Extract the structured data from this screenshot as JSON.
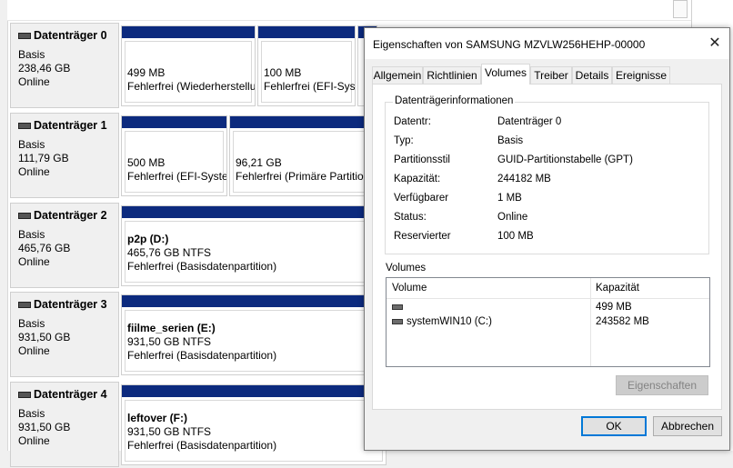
{
  "disks": [
    {
      "name": "Datenträger 0",
      "type": "Basis",
      "size": "238,46 GB",
      "status": "Online",
      "partitions": [
        {
          "title": "",
          "line1": "499 MB",
          "line2": "Fehlerfrei (Wiederherstellu"
        },
        {
          "title": "",
          "line1": "100 MB",
          "line2": "Fehlerfrei (EFI-Syst"
        },
        {
          "title": "",
          "line1": "",
          "line2": ""
        }
      ]
    },
    {
      "name": "Datenträger 1",
      "type": "Basis",
      "size": "111,79 GB",
      "status": "Online",
      "partitions": [
        {
          "title": "",
          "line1": "500 MB",
          "line2": "Fehlerfrei (EFI-Syste"
        },
        {
          "title": "",
          "line1": "96,21 GB",
          "line2": "Fehlerfrei (Primäre Partition"
        }
      ]
    },
    {
      "name": "Datenträger 2",
      "type": "Basis",
      "size": "465,76 GB",
      "status": "Online",
      "partitions": [
        {
          "title": "p2p  (D:)",
          "line1": "465,76 GB NTFS",
          "line2": "Fehlerfrei (Basisdatenpartition)"
        }
      ]
    },
    {
      "name": "Datenträger 3",
      "type": "Basis",
      "size": "931,50 GB",
      "status": "Online",
      "partitions": [
        {
          "title": "fiilme_serien  (E:)",
          "line1": "931,50 GB NTFS",
          "line2": "Fehlerfrei (Basisdatenpartition)"
        }
      ]
    },
    {
      "name": "Datenträger 4",
      "type": "Basis",
      "size": "931,50 GB",
      "status": "Online",
      "partitions": [
        {
          "title": "leftover  (F:)",
          "line1": "931,50 GB NTFS",
          "line2": "Fehlerfrei (Basisdatenpartition)"
        }
      ]
    }
  ],
  "dialog": {
    "title": "Eigenschaften von SAMSUNG MZVLW256HEHP-00000",
    "close_icon": "close-icon",
    "tabs": [
      "Allgemein",
      "Richtlinien",
      "Volumes",
      "Treiber",
      "Details",
      "Ereignisse"
    ],
    "active_tab": "Volumes",
    "info_group_label": "Datenträgerinformationen",
    "info": [
      {
        "label": "Datentr:",
        "value": "Datenträger 0"
      },
      {
        "label": "Typ:",
        "value": "Basis"
      },
      {
        "label": "Partitionsstil",
        "value": "GUID-Partitionstabelle (GPT)"
      },
      {
        "label": "Kapazität:",
        "value": "244182 MB"
      },
      {
        "label": "Verfügbarer",
        "value": "1 MB"
      },
      {
        "label": "Status:",
        "value": "Online"
      },
      {
        "label": "Reservierter",
        "value": "100 MB"
      }
    ],
    "volumes_label": "Volumes",
    "volumes_columns": [
      "Volume",
      "Kapazität"
    ],
    "volumes": [
      {
        "volume": "",
        "capacity": "499 MB"
      },
      {
        "volume": "systemWIN10 (C:)",
        "capacity": "243582 MB"
      }
    ],
    "properties_button": "Eigenschaften",
    "ok_button": "OK",
    "cancel_button": "Abbrechen"
  }
}
